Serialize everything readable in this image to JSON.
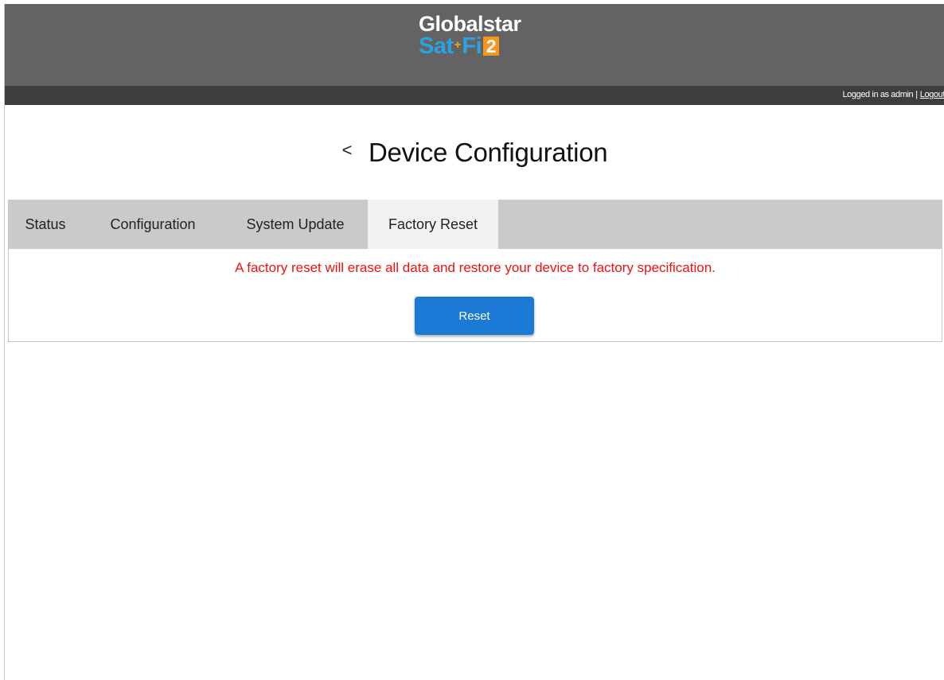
{
  "brand": {
    "line1": "Globalstar",
    "line2_sat": "Sat",
    "line2_plus": "+",
    "line2_fi": "Fi",
    "line2_num": "2"
  },
  "topbar": {
    "logged_in_text": "Logged in as admin",
    "separator": "|",
    "logout_label": "Logout"
  },
  "page": {
    "back_icon": "<",
    "title": "Device Configuration"
  },
  "tabs": [
    {
      "label": "Status",
      "active": false
    },
    {
      "label": "Configuration",
      "active": false
    },
    {
      "label": "System Update",
      "active": false
    },
    {
      "label": "Factory Reset",
      "active": true
    }
  ],
  "factory_reset": {
    "warning": "A factory reset will erase all data and restore your device to factory specification.",
    "button_label": "Reset"
  },
  "colors": {
    "header_bg": "#636363",
    "subbar_bg": "#3d3d3d",
    "tabbar_bg": "#cacaca",
    "active_tab_bg": "#f1f1f1",
    "warning_text": "#ee1111",
    "button_bg": "#1b7ad6",
    "brand_blue": "#2aa3e4",
    "brand_orange": "#f7941d"
  },
  "icons": {
    "back": "chevron-left-icon"
  }
}
